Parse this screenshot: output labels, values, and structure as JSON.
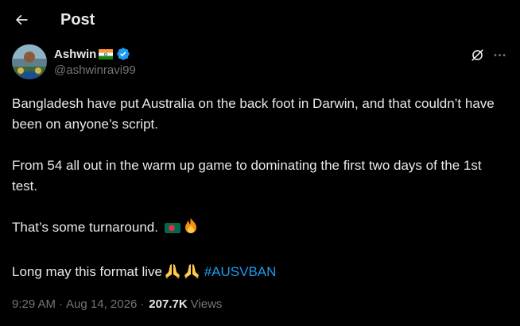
{
  "header": {
    "title": "Post"
  },
  "author": {
    "display_name": "Ashwin",
    "handle": "@ashwinravi99",
    "flag_icon": "india-flag-icon",
    "verified_icon": "verified-badge-icon",
    "verified_color": "#1d9bf0"
  },
  "tweet": {
    "line1": "Bangladesh have put Australia on the back foot in Darwin, and that couldn’t have been on anyone’s script.",
    "line2": "From 54 all out in the warm up game to dominating the first two days of the 1st test.",
    "line3": "That’s some turnaround.",
    "line4": "Long may this format live",
    "hashtag": "#AUSVBAN",
    "emoji_line3": [
      "bangladesh-flag-icon",
      "fire-icon"
    ],
    "emoji_line4": [
      "folded-hands-icon",
      "folded-hands-icon"
    ]
  },
  "meta": {
    "time": "9:29 AM",
    "separator": "·",
    "date": "Aug 14, 2026",
    "dot": "·",
    "views_count": "207.7K",
    "views_label": "Views"
  },
  "colors": {
    "background": "#000000",
    "text": "#e7e9ea",
    "secondary_text": "#71767b",
    "link": "#1d9bf0"
  },
  "icons": {
    "back": "back-arrow-icon",
    "grok": "grok-icon",
    "more": "more-icon"
  }
}
